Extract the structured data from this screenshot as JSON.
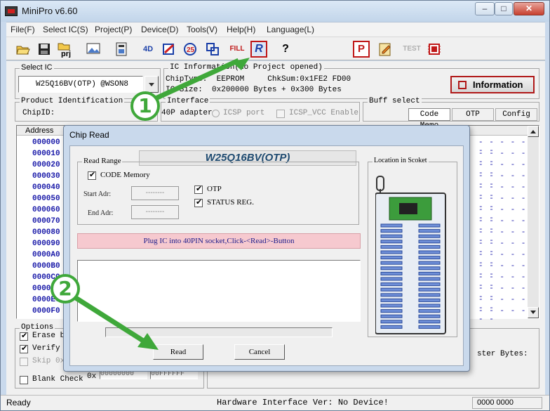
{
  "window": {
    "title": "MiniPro v6.60"
  },
  "menu": [
    "File(F)",
    "Select IC(S)",
    "Project(P)",
    "Device(D)",
    "Tools(V)",
    "Help(H)",
    "Language(L)"
  ],
  "toolbar": {
    "fill_label": "FILL",
    "read_label": "R",
    "help_label": "?",
    "test_label": "TEST",
    "p_label": "P",
    "4d_label": "4D"
  },
  "select_ic": {
    "title": "Select IC",
    "value": "W25Q16BV(OTP) @WSON8"
  },
  "ic_info": {
    "title": "IC Information(No Project opened)",
    "line1": "ChipType:  EEPROM     ChkSum:0x1FE2 FD00",
    "line2": "IC Size:  0x200000 Bytes + 0x300 Bytes",
    "button": "Information"
  },
  "product": {
    "title": "Product Identification",
    "chip_id_label": "ChipID:"
  },
  "interface": {
    "title": "Interface",
    "opt1": "40P adapter",
    "opt2": "ICSP port",
    "opt3": "ICSP_VCC Enable"
  },
  "buff_select": {
    "title": "Buff select",
    "tabs": [
      "Code Memo",
      "OTP",
      "Config"
    ]
  },
  "hex_view": {
    "address_header": "Address",
    "addresses": [
      "000000",
      "000010",
      "000020",
      "000030",
      "000040",
      "000050",
      "000060",
      "000070",
      "000080",
      "000090",
      "0000A0",
      "0000B0",
      "0000C0",
      "0000D0",
      "0000E0",
      "0000F0"
    ],
    "dots": "- - - - - - -"
  },
  "options": {
    "title": "Options",
    "items": [
      "Erase be",
      "Verify a",
      "Skip 0xF",
      "Blank Check"
    ],
    "hex_prefix": "0x",
    "hex_val1": "00000000",
    "hex_val2": "00FFFFFF"
  },
  "right_panel": {
    "ster_bytes": "ster Bytes:"
  },
  "status": {
    "left": "Ready",
    "center": "Hardware Interface Ver: No Device!",
    "right": "0000 0000"
  },
  "dialog": {
    "title": "Chip Read",
    "chip_name": "W25Q16BV(OTP)",
    "read_range_title": "Read Range",
    "code_memory": "CODE Memory",
    "start_adr_label": "Start Adr:",
    "end_adr_label": "End Adr:",
    "start_adr_value": "--------",
    "end_adr_value": "--------",
    "otp": "OTP",
    "status_reg": "STATUS REG.",
    "location_title": "Location in Scoket",
    "message": "Plug IC into 40PIN socket,Click-<Read>-Button",
    "read_button": "Read",
    "cancel_button": "Cancel"
  },
  "callouts": [
    "1",
    "2"
  ],
  "colors": {
    "accent_green": "#3fa83a",
    "message_bg": "#f6c9cf",
    "info_button_border": "#b01818",
    "address_blue": "#1818a8"
  }
}
